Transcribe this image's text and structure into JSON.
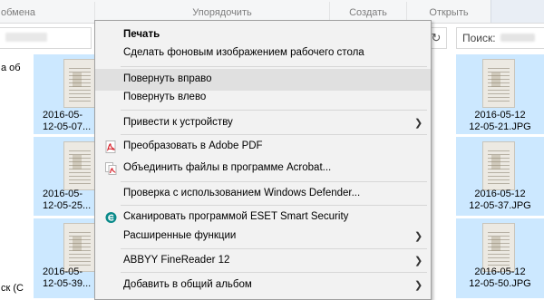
{
  "ribbon": {
    "groups": {
      "share": "обмена",
      "organize": "Упорядочить",
      "create": "Создать",
      "open": "Открыть"
    }
  },
  "address": {
    "refresh_icon": "↻"
  },
  "search": {
    "label": "Поиск:"
  },
  "nav": {
    "items": [
      "а об",
      "ск (C"
    ]
  },
  "files": {
    "left": [
      {
        "line1": "2016-05-",
        "line2": "12-05-07..."
      },
      {
        "line1": "2016-05-",
        "line2": "12-05-25..."
      },
      {
        "line1": "2016-05-",
        "line2": "12-05-39..."
      }
    ],
    "right": [
      {
        "line1": "2016-05-12",
        "line2": "12-05-21.JPG"
      },
      {
        "line1": "2016-05-12",
        "line2": "12-05-37.JPG"
      },
      {
        "line1": "2016-05-12",
        "line2": "12-05-50.JPG"
      }
    ]
  },
  "context_menu": {
    "items": {
      "print": "Печать",
      "set_wallpaper": "Сделать фоновым изображением рабочего стола",
      "rotate_right": "Повернуть вправо",
      "rotate_left": "Повернуть влево",
      "cast_to_device": "Привести к устройству",
      "convert_pdf": "Преобразовать в Adobe PDF",
      "combine_acrobat": "Объединить файлы в программе Acrobat...",
      "defender_scan": "Проверка с использованием Windows Defender...",
      "eset_scan": "Сканировать программой ESET Smart Security",
      "advanced": "Расширенные функции",
      "abbyy": "ABBYY FineReader 12",
      "shared_album": "Добавить в общий альбом"
    },
    "submenu_arrow": "❯",
    "hovered_item": "rotate_right",
    "icons": {
      "pdf": "adobe-pdf-icon",
      "acrobat": "acrobat-combine-icon",
      "eset": "eset-icon"
    }
  },
  "colors": {
    "selection": "#cce8ff",
    "menu_bg": "#f2f2f2",
    "menu_hover": "#e0e0e0",
    "adobe_red": "#d7262f",
    "eset_teal": "#0a8a8a"
  }
}
